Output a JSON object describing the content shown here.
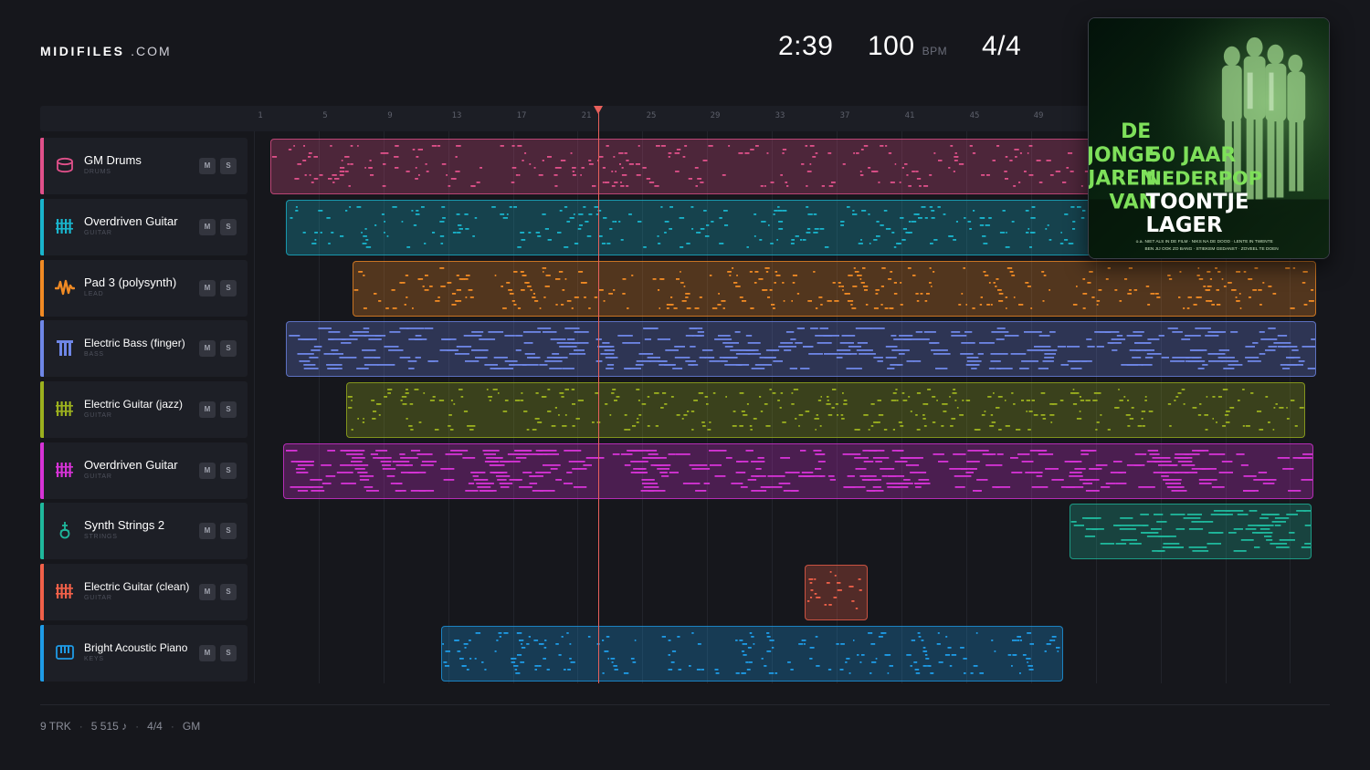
{
  "brand": {
    "name": "MIDIFILES",
    "suffix": ".COM"
  },
  "header": {
    "time": "2:39",
    "bpm": "100",
    "bpm_unit": "BPM",
    "time_signature": "4/4"
  },
  "ruler": {
    "bars": [
      "1",
      "5",
      "9",
      "13",
      "17",
      "21",
      "25",
      "29",
      "33",
      "37",
      "41",
      "45",
      "49"
    ]
  },
  "tracks": [
    {
      "name": "GM Drums",
      "category": "DRUMS",
      "color": "#e0508a",
      "icon": "drum-icon",
      "mute": "M",
      "solo": "S"
    },
    {
      "name": "Overdriven Guitar",
      "category": "GUITAR",
      "color": "#19b4cc",
      "icon": "guitar-grid-icon",
      "mute": "M",
      "solo": "S"
    },
    {
      "name": "Pad 3 (polysynth)",
      "category": "LEAD",
      "color": "#f08a24",
      "icon": "waveform-icon",
      "mute": "M",
      "solo": "S"
    },
    {
      "name": "Electric Bass (finger)",
      "category": "BASS",
      "color": "#6e86e6",
      "icon": "bass-icon",
      "mute": "M",
      "solo": "S"
    },
    {
      "name": "Electric Guitar (jazz)",
      "category": "GUITAR",
      "color": "#9bb01e",
      "icon": "guitar-grid-icon",
      "mute": "M",
      "solo": "S"
    },
    {
      "name": "Overdriven Guitar",
      "category": "GUITAR",
      "color": "#d633d6",
      "icon": "guitar-grid-icon",
      "mute": "M",
      "solo": "S"
    },
    {
      "name": "Synth Strings 2",
      "category": "STRINGS",
      "color": "#1fb89c",
      "icon": "strings-icon",
      "mute": "M",
      "solo": "S"
    },
    {
      "name": "Electric Guitar (clean)",
      "category": "GUITAR",
      "color": "#f06049",
      "icon": "guitar-grid-icon",
      "mute": "M",
      "solo": "S"
    },
    {
      "name": "Bright Acoustic Piano",
      "category": "KEYS",
      "color": "#1e9be6",
      "icon": "piano-icon",
      "mute": "M",
      "solo": "S"
    }
  ],
  "album": {
    "title_words": [
      "DE",
      "JONGE",
      "JAREN",
      "VAN",
      "50 JAAR",
      "NEDERPOP",
      "TOONTJE",
      "LAGER"
    ],
    "tracklist_line1": "NIET ALS IN DE FILM · NIKS NA DE DOOD · LENTE IN TWENTE",
    "tracklist_line2": "BEN JIJ OOK ZO BANG · STIEKEM GEDANST · ZOVEEL TE DOEN",
    "prefix": "o.a."
  },
  "footer": {
    "tracks": "9 TRK",
    "notes": "5 515 ♪",
    "time_signature": "4/4",
    "standard": "GM"
  }
}
